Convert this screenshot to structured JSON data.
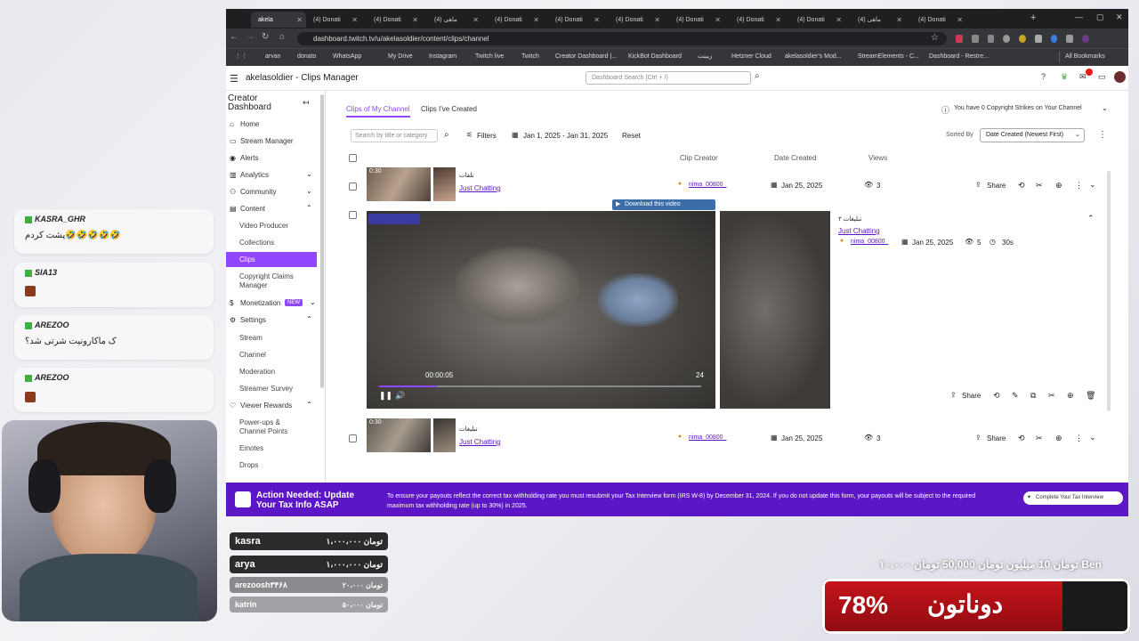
{
  "browser": {
    "tabs": [
      "akela",
      "(4) Donati",
      "(4) Donati",
      "(4) ماهی",
      "(4) Donati",
      "(4) Donati",
      "(4) Donati",
      "(4) Donati",
      "(4) Donati",
      "(4) Donati",
      "(4) ماهی",
      "(4) Donati"
    ],
    "url": "dashboard.twitch.tv/u/akelasoldier/content/clips/channel",
    "bookmarks": [
      "arvan",
      "donato",
      "WhatsApp",
      "My Drive",
      "Instagram",
      "Twitch live",
      "Twitch",
      "Creator Dashboard |...",
      "KickBot Dashboard",
      "زیبنت",
      "Hetzner Cloud",
      "akelasoldier's Mod...",
      "StreamElements - C...",
      "Dashboard - Restre..."
    ],
    "all_bookmarks": "All Bookmarks"
  },
  "topnav": {
    "title": "akelasoldier - Clips Manager",
    "search_placeholder": "Dashboard Search (Ctrl + /)"
  },
  "sidebar": {
    "heading": "Creator Dashboard",
    "items": {
      "home": "Home",
      "stream_manager": "Stream Manager",
      "alerts": "Alerts",
      "analytics": "Analytics",
      "community": "Community",
      "content": "Content",
      "video_producer": "Video Producer",
      "collections": "Collections",
      "clips": "Clips",
      "copyright": "Copyright Claims Manager",
      "monetization": "Monetization",
      "new_badge": "NEW",
      "settings": "Settings",
      "stream": "Stream",
      "channel": "Channel",
      "moderation": "Moderation",
      "streamer_survey": "Streamer Survey",
      "viewer_rewards": "Viewer Rewards",
      "powerups": "Power-ups & Channel Points",
      "emotes": "Emotes",
      "drops": "Drops"
    }
  },
  "main": {
    "tabs": [
      "Clips of My Channel",
      "Clips I've Created"
    ],
    "strikes": "You have 0 Copyright Strikes on Your Channel",
    "search_placeholder": "Search by title or category",
    "filters": "Filters",
    "date_range": "Jan 1, 2025 - Jan 31, 2025",
    "reset": "Reset",
    "sorted_by": "Sorted By",
    "sort_value": "Date Created (Newest First)",
    "columns": {
      "creator": "Clip Creator",
      "date": "Date Created",
      "views": "Views"
    },
    "share": "Share",
    "rows": [
      {
        "duration": "0:30",
        "title": "تلفات",
        "category": "Just Chatting",
        "creator": "nima_00800_",
        "date": "Jan 25, 2025",
        "views": "3"
      },
      {
        "duration": "0:30",
        "title": "تبلیغات ۲",
        "category": "Just Chatting",
        "creator": "nima_00800_",
        "date": "Jan 25, 2025",
        "views": "5",
        "length": "30s"
      },
      {
        "duration": "0:30",
        "title": "تبلیغات",
        "category": "Just Chatting",
        "creator": "nima_00800_",
        "date": "Jan 25, 2025",
        "views": "3"
      }
    ],
    "player": {
      "download": "Download this video",
      "time": "00:00:05",
      "counter": "24",
      "progress": 0.18
    }
  },
  "banner": {
    "title": "Action Needed: Update Your Tax Info ASAP",
    "text": "To ensure your payouts reflect the correct tax withholding rate you must resubmit your Tax Interview form (IRS W-8) by December 31, 2024. If you do not update this form, your payouts will be subject to the required maximum tax withholding rate (up to 30%) in 2025.",
    "button": "Complete Your Tax Interview"
  },
  "chat": [
    {
      "name": "KASRA_GHR",
      "text": "پشت کردم🤣🤣🤣🤣🤣"
    },
    {
      "name": "SIA13",
      "text": ""
    },
    {
      "name": "AREZOO",
      "text": "ک ماکارونیت شرتی شد؟"
    },
    {
      "name": "AREZOO",
      "text": ""
    }
  ],
  "donations": [
    {
      "name": "kasra",
      "amount": "۱،۰۰۰،۰۰۰ تومان"
    },
    {
      "name": "arya",
      "amount": "۱،۰۰۰،۰۰۰ تومان"
    },
    {
      "name": "arezoosh۳۴۶۸",
      "amount": "۲۰،۰۰۰ تومان"
    },
    {
      "name": "katrin",
      "amount": "۵۰،۰۰۰ تومان"
    }
  ],
  "donaton": {
    "goal_line": "۱۰،۰۰۰ تومان  10 میلیون تومان  50,000 تومان  Ben",
    "percent": "78%",
    "label": "دوناتون",
    "progress": 0.78
  },
  "colors": {
    "twitch_purple": "#9147ff",
    "banner": "#5c16c5",
    "donaton_red": "#b01017"
  }
}
